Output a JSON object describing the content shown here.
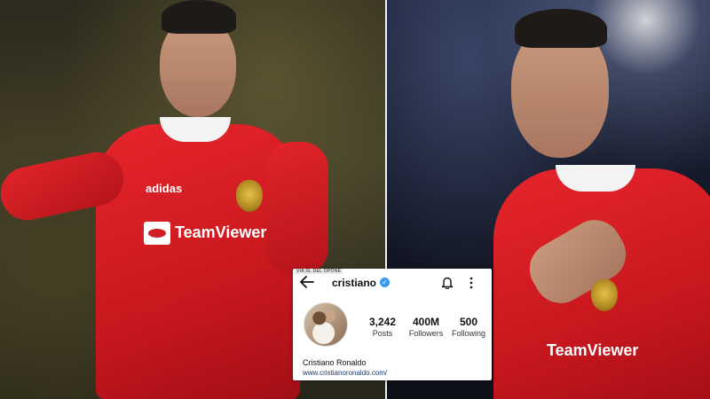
{
  "left_photo": {
    "kit_brand": "adidas",
    "sponsor": "TeamViewer",
    "kit_color": "#da1f26"
  },
  "right_photo": {
    "sponsor": "TeamViewer",
    "kit_color": "#c8171e"
  },
  "instagram": {
    "watermark": "VIA SL DEL OPONE",
    "username": "cristiano",
    "verified": true,
    "stats": {
      "posts": {
        "value": "3,242",
        "label": "Posts"
      },
      "followers": {
        "value": "400M",
        "label": "Followers"
      },
      "following": {
        "value": "500",
        "label": "Following"
      }
    },
    "display_name": "Cristiano Ronaldo",
    "link": "www.cristianoronaldo.com/",
    "verified_color": "#3897f0"
  }
}
